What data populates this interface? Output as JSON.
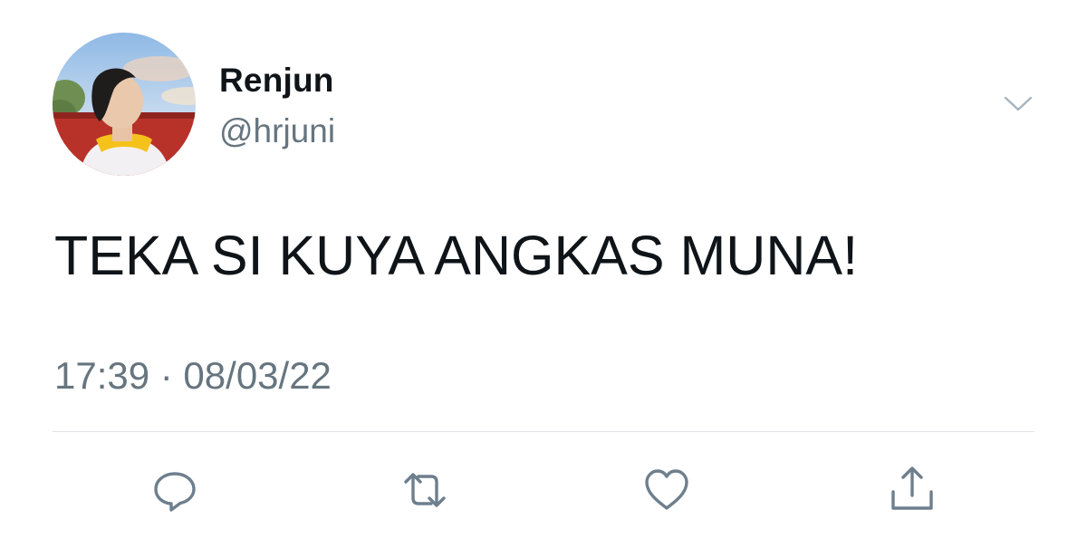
{
  "user": {
    "display_name": "Renjun",
    "handle": "@hrjuni"
  },
  "tweet": {
    "text": "TEKA SI KUYA ANGKAS MUNA!",
    "timestamp": "17:39 · 08/03/22"
  },
  "actions": [
    {
      "name": "reply",
      "icon": "reply-icon"
    },
    {
      "name": "retweet",
      "icon": "retweet-icon"
    },
    {
      "name": "like",
      "icon": "heart-icon"
    },
    {
      "name": "share",
      "icon": "share-icon"
    }
  ],
  "colors": {
    "text_primary": "#0f1419",
    "text_secondary": "#66757f",
    "icon": "#6e7f8d",
    "divider": "#dfe3e6"
  }
}
